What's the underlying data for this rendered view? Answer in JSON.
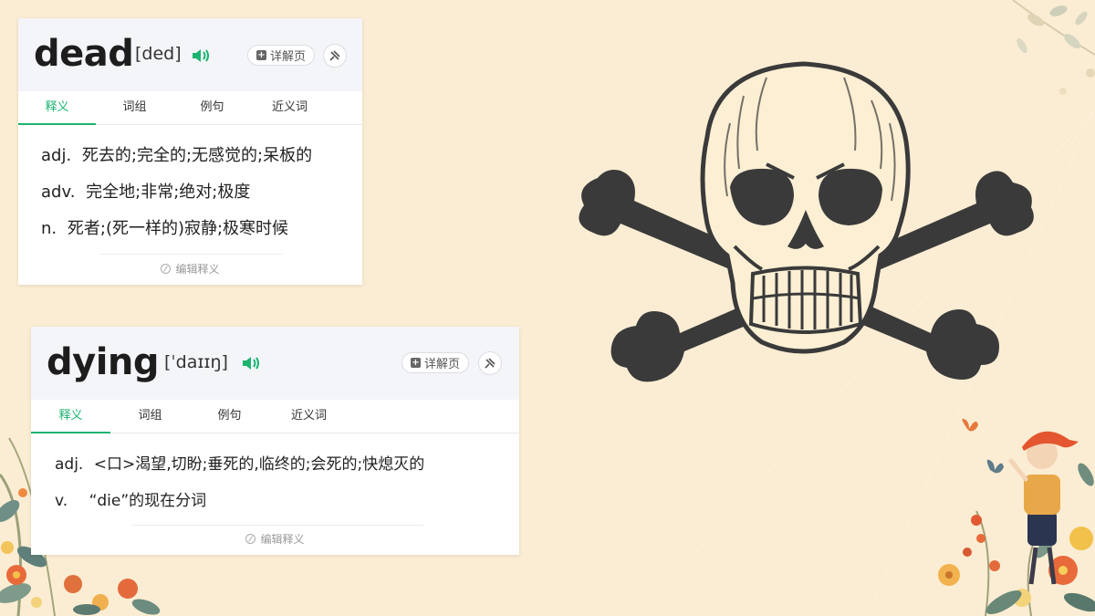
{
  "colors": {
    "background": "#fbedd3",
    "accent_green": "#1bb46f",
    "skull_dark": "#3a3a3a",
    "skull_light": "#fcefd4"
  },
  "cards": [
    {
      "word": "dead",
      "phonetic": "[ded]",
      "detail_label": "详解页",
      "tabs": [
        "释义",
        "词组",
        "例句",
        "近义词"
      ],
      "active_tab": "释义",
      "definitions": [
        {
          "pos": "adj.",
          "text": "死去的;完全的;无感觉的;呆板的"
        },
        {
          "pos": "adv.",
          "text": "完全地;非常;绝对;极度"
        },
        {
          "pos": "n.",
          "text": "死者;(死一样的)寂静;极寒时候"
        }
      ],
      "edit_label": "编辑释义"
    },
    {
      "word": "dying",
      "phonetic": "[ˈdaɪɪŋ]",
      "detail_label": "详解页",
      "tabs": [
        "释义",
        "词组",
        "例句",
        "近义词"
      ],
      "active_tab": "释义",
      "definitions": [
        {
          "pos": "adj.",
          "text": "<口>渴望,切盼;垂死的,临终的;会死的;快熄灭的"
        },
        {
          "pos": "v.",
          "text": "“die”的现在分词"
        }
      ],
      "edit_label": "编辑释义"
    }
  ],
  "icons": {
    "speaker": "speaker-icon",
    "detail": "plus-box-icon",
    "pin": "pin-icon",
    "edit": "edit-pencil-icon",
    "illustration": "skull-crossbones-icon"
  }
}
